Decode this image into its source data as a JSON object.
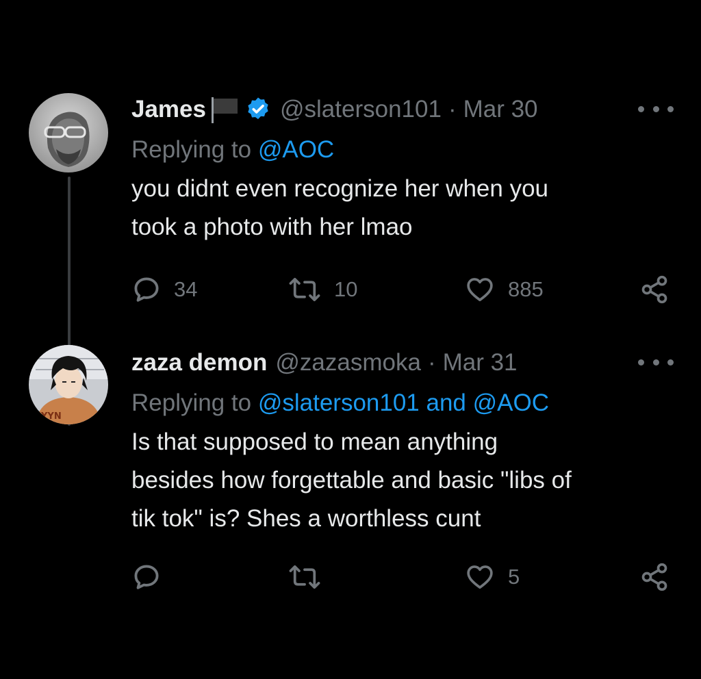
{
  "tweets": [
    {
      "display_name": "James",
      "verified": true,
      "handle": "@slaterson101",
      "separator": "·",
      "date": "Mar 30",
      "replying_prefix": "Replying to ",
      "replying_to": "@AOC",
      "text": "you didnt even recognize her when you\ntook a photo with her lmao",
      "replies": "34",
      "retweets": "10",
      "likes": "885"
    },
    {
      "display_name": "zaza demon",
      "verified": false,
      "handle": "@zazasmoka",
      "separator": "·",
      "date": "Mar 31",
      "replying_prefix": "Replying to ",
      "replying_to": "@slaterson101 and @AOC",
      "text": "Is that supposed to mean anything\nbesides how forgettable and basic \"libs of\ntik tok\" is? Shes a worthless cunt",
      "replies": "",
      "retweets": "",
      "likes": "5"
    }
  ],
  "icons": {
    "reply": "reply-icon",
    "retweet": "retweet-icon",
    "like": "heart-icon",
    "share": "share-icon",
    "more": "more-icon",
    "verified": "verified-badge-icon",
    "flag": "black-flag-icon"
  },
  "colors": {
    "background": "#000000",
    "primary_text": "#e7e9ea",
    "secondary_text": "#71767b",
    "link": "#1d9bf0",
    "verified": "#1d9bf0"
  }
}
